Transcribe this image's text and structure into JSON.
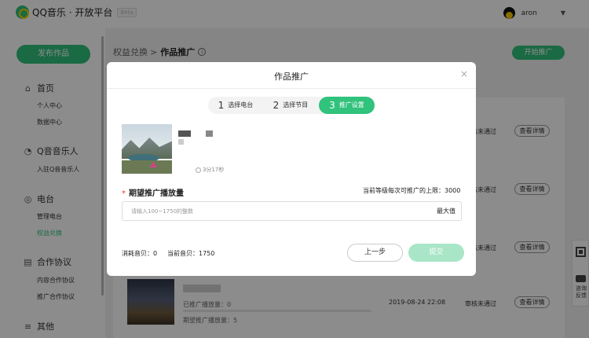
{
  "header": {
    "logo_text": "QQ音乐 · 开放平台",
    "beta_tag": "Beta",
    "username": "aron",
    "caret": "▼"
  },
  "sidebar": {
    "publish_label": "发布作品",
    "groups": [
      {
        "title": "首页",
        "icon": "home-icon",
        "items": [
          "个人中心",
          "数据中心"
        ]
      },
      {
        "title": "Q音音乐人",
        "icon": "musician-icon",
        "items": [
          "入驻Q音音乐人"
        ]
      },
      {
        "title": "电台",
        "icon": "radio-icon",
        "items": [
          "管理电台",
          "权益兑换"
        ]
      },
      {
        "title": "合作协议",
        "icon": "document-icon",
        "items": [
          "内容合作协议",
          "推广合作协议"
        ]
      },
      {
        "title": "其他",
        "icon": "menu-icon",
        "items": []
      }
    ],
    "active_item": "权益兑换"
  },
  "breadcrumb": {
    "parent": "权益兑换",
    "separator": ">",
    "current": "作品推广",
    "info_icon": "i"
  },
  "main": {
    "start_promo_label": "开始推广",
    "rows": [
      {
        "status": "审核未通过",
        "detail_label": "查看详情"
      },
      {
        "status": "审核未通过",
        "detail_label": "查看详情"
      },
      {
        "status": "审核未通过",
        "detail_label": "查看详情"
      },
      {
        "status": "审核未通过",
        "detail_label": "查看详情"
      },
      {
        "status": "审核未通过",
        "detail_label": "查看详情"
      }
    ],
    "last_row": {
      "promoted_plays": "已推广播放量：0",
      "expected_plays": "期望推广播放量：5",
      "time": "2019-08-24 22:08"
    }
  },
  "side_float": {
    "feedback": "咨询反馈"
  },
  "modal": {
    "title": "作品推广",
    "close": "×",
    "steps": [
      {
        "num": "1",
        "label": "选择电台"
      },
      {
        "num": "2",
        "label": "选择节目"
      },
      {
        "num": "3",
        "label": "推广设置"
      }
    ],
    "active_step": 3,
    "duration": "3分17秒",
    "field_label": "期望推广播放量",
    "required_mark": "*",
    "limit_text": "当前等级每次可推广的上限：3000",
    "input_placeholder": "请输入100~1750的整数",
    "input_value": "",
    "max_label": "最大值",
    "consume_text": "消耗音贝：0",
    "current_text": "当前音贝：1750",
    "prev_label": "上一步",
    "submit_label": "提交"
  },
  "colors": {
    "accent": "#31c27c",
    "accent_disabled": "#a8e6c7"
  }
}
